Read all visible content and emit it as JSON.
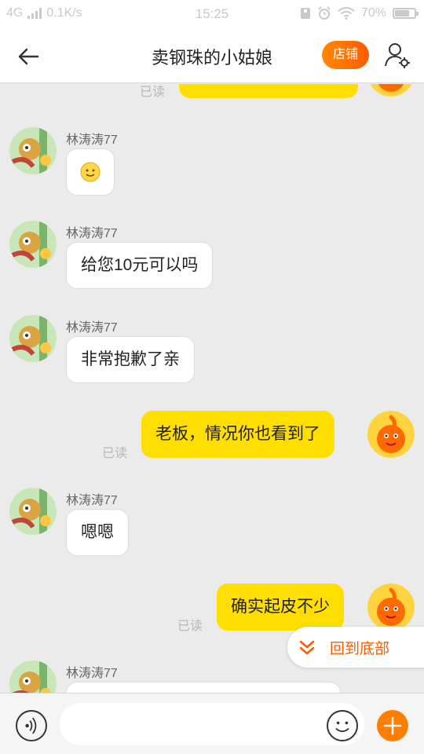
{
  "status_bar": {
    "network": "4G",
    "speed": "0.1K/s",
    "time": "15:25",
    "battery": "70%",
    "battery_level": 0.7
  },
  "header": {
    "title": "卖钢珠的小姑娘",
    "shop_label": "店铺"
  },
  "chat": {
    "partial_read": "已读",
    "messages": [
      {
        "sender": "林涛涛77",
        "text": ""
      },
      {
        "sender": "林涛涛77",
        "text": "给您10元可以吗"
      },
      {
        "sender": "林涛涛77",
        "text": "非常抱歉了亲"
      },
      {
        "text": "老板，情况你也看到了",
        "read": "已读"
      },
      {
        "sender": "林涛涛77",
        "text": "嗯嗯"
      },
      {
        "text": "确实起皮不少",
        "read": "已读"
      },
      {
        "sender": "林涛涛77",
        "text": ""
      }
    ]
  },
  "back_to_bottom": "回到底部",
  "input": {
    "placeholder": ""
  },
  "colors": {
    "accent": "#ff5a00",
    "outgoing_bubble": "#ffde00",
    "background": "#ebebeb"
  }
}
